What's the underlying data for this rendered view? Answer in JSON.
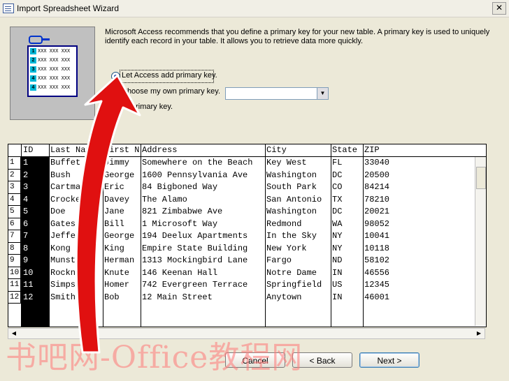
{
  "window": {
    "title": "Import Spreadsheet Wizard",
    "close_glyph": "✕"
  },
  "description": "Microsoft Access recommends that you define a primary key for your new table. A primary key is used to uniquely identify each record in your table. It allows you to retrieve data more quickly.",
  "options": [
    {
      "label": "Let Access add primary key.",
      "selected": true
    },
    {
      "label": "Choose my own primary key.",
      "selected": false
    },
    {
      "label": "No primary key.",
      "visible_label": "primary key.",
      "selected": false
    }
  ],
  "wizard_image": {
    "rows": [
      {
        "n": "1",
        "text": "XXX XXX XXX"
      },
      {
        "n": "2",
        "text": "XXX XXX XXX"
      },
      {
        "n": "3",
        "text": "XXX XXX XXX"
      },
      {
        "n": "4",
        "text": "XXX XXX XXX"
      },
      {
        "n": "4",
        "text": "XXX XXX XXX"
      }
    ]
  },
  "table": {
    "columns": [
      "ID",
      "Last Name",
      "First Name",
      "Address",
      "City",
      "State",
      "ZIP"
    ],
    "columns_visible": [
      "ID",
      "Last Nan",
      "First N",
      "Address",
      "City",
      "State",
      "ZIP"
    ],
    "rows": [
      [
        "1",
        "Buffet",
        "Jimmy",
        "Somewhere on the Beach",
        "Key West",
        "FL",
        "33040"
      ],
      [
        "2",
        "Bush",
        "George",
        "1600 Pennsylvania Ave",
        "Washington",
        "DC",
        "20500"
      ],
      [
        "3",
        "Cartman",
        "Eric",
        "84 Bigboned Way",
        "South Park",
        "CO",
        "84214"
      ],
      [
        "4",
        "Crockett",
        "Davey",
        "The Alamo",
        "San Antonio",
        "TX",
        "78210"
      ],
      [
        "5",
        "Doe",
        "Jane",
        "821 Zimbabwe Ave",
        "Washington",
        "DC",
        "20021"
      ],
      [
        "6",
        "Gates",
        "Bill",
        "1 Microsoft Way",
        "Redmond",
        "WA",
        "98052"
      ],
      [
        "7",
        "Jefferson",
        "George",
        "194 Deelux Apartments",
        "In the Sky",
        "NY",
        "10041"
      ],
      [
        "8",
        "Kong",
        "King",
        "Empire State Building",
        "New York",
        "NY",
        "10118"
      ],
      [
        "9",
        "Munster",
        "Herman",
        "1313 Mockingbird Lane",
        "Fargo",
        "ND",
        "58102"
      ],
      [
        "10",
        "Rockne",
        "Knute",
        "146 Keenan Hall",
        "Notre Dame",
        "IN",
        "46556"
      ],
      [
        "11",
        "Simpson",
        "Homer",
        "742 Evergreen Terrace",
        "Springfield",
        "US",
        "12345"
      ],
      [
        "12",
        "Smith",
        "Bob",
        "12 Main Street",
        "Anytown",
        "IN",
        "46001"
      ]
    ]
  },
  "buttons": {
    "cancel": "Cancel",
    "back": "< Back",
    "next": "Next >"
  },
  "watermark": "书吧网-Office教程网",
  "colors": {
    "arrow": "#e01010",
    "id_column": "#000000",
    "radio_dot": "#2148a8"
  },
  "icons": [
    "app-icon",
    "close-icon",
    "key-icon",
    "dropdown-arrow-icon",
    "scroll-left-icon",
    "scroll-right-icon",
    "pointer-arrow-icon"
  ]
}
